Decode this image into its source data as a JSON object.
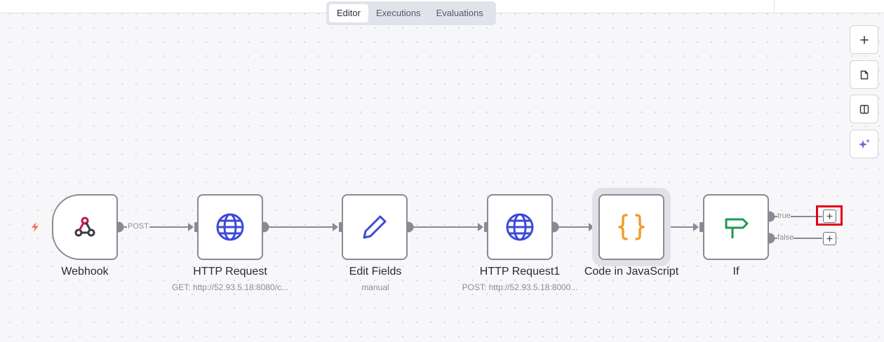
{
  "header": {
    "tabs": [
      {
        "label": "Editor",
        "active": true
      },
      {
        "label": "Executions",
        "active": false
      },
      {
        "label": "Evaluations",
        "active": false
      }
    ]
  },
  "canvas_controls": [
    {
      "name": "zoom-in",
      "icon": "plus-icon"
    },
    {
      "name": "sticky-note",
      "icon": "sticky-note-icon"
    },
    {
      "name": "toggle-panel",
      "icon": "panel-icon"
    },
    {
      "name": "ai-assistant",
      "icon": "sparkles-icon"
    }
  ],
  "nodes": [
    {
      "title": "Webhook",
      "subtitle": "",
      "icon": "webhook-icon"
    },
    {
      "title": "HTTP Request",
      "subtitle": "GET: http://52.93.5.18:8080/c...",
      "icon": "globe-icon"
    },
    {
      "title": "Edit Fields",
      "subtitle": "manual",
      "icon": "pencil-icon"
    },
    {
      "title": "HTTP Request1",
      "subtitle": "POST: http://52.93.5.18:8000...",
      "icon": "globe-icon"
    },
    {
      "title": "Code in JavaScript",
      "subtitle": "",
      "icon": "braces-icon"
    },
    {
      "title": "If",
      "subtitle": "",
      "icon": "signpost-icon"
    }
  ],
  "connection_labels": {
    "webhook_method": "POST",
    "if_true": "true",
    "if_false": "false"
  },
  "colors": {
    "accent": "#e3001b",
    "trigger": "#ff6d5a",
    "globe": "#3a4ad9",
    "code": "#f29d2c",
    "if": "#1a9c4d",
    "ai": "#8a5cdc"
  }
}
